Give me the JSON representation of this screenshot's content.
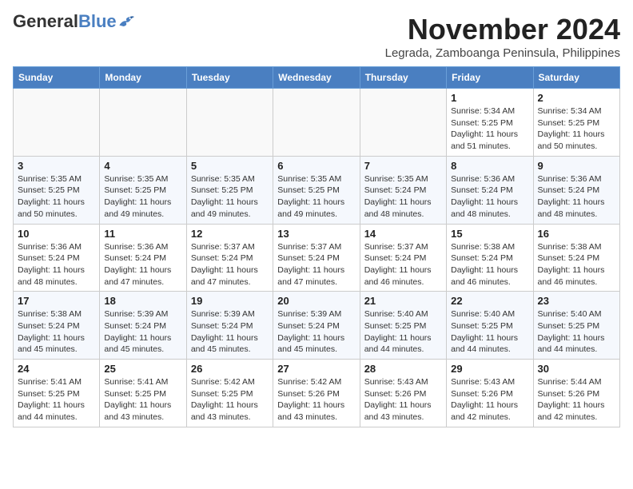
{
  "header": {
    "logo_general": "General",
    "logo_blue": "Blue",
    "month_title": "November 2024",
    "subtitle": "Legrada, Zamboanga Peninsula, Philippines"
  },
  "weekdays": [
    "Sunday",
    "Monday",
    "Tuesday",
    "Wednesday",
    "Thursday",
    "Friday",
    "Saturday"
  ],
  "weeks": [
    [
      {
        "day": "",
        "info": ""
      },
      {
        "day": "",
        "info": ""
      },
      {
        "day": "",
        "info": ""
      },
      {
        "day": "",
        "info": ""
      },
      {
        "day": "",
        "info": ""
      },
      {
        "day": "1",
        "info": "Sunrise: 5:34 AM\nSunset: 5:25 PM\nDaylight: 11 hours and 51 minutes."
      },
      {
        "day": "2",
        "info": "Sunrise: 5:34 AM\nSunset: 5:25 PM\nDaylight: 11 hours and 50 minutes."
      }
    ],
    [
      {
        "day": "3",
        "info": "Sunrise: 5:35 AM\nSunset: 5:25 PM\nDaylight: 11 hours and 50 minutes."
      },
      {
        "day": "4",
        "info": "Sunrise: 5:35 AM\nSunset: 5:25 PM\nDaylight: 11 hours and 49 minutes."
      },
      {
        "day": "5",
        "info": "Sunrise: 5:35 AM\nSunset: 5:25 PM\nDaylight: 11 hours and 49 minutes."
      },
      {
        "day": "6",
        "info": "Sunrise: 5:35 AM\nSunset: 5:25 PM\nDaylight: 11 hours and 49 minutes."
      },
      {
        "day": "7",
        "info": "Sunrise: 5:35 AM\nSunset: 5:24 PM\nDaylight: 11 hours and 48 minutes."
      },
      {
        "day": "8",
        "info": "Sunrise: 5:36 AM\nSunset: 5:24 PM\nDaylight: 11 hours and 48 minutes."
      },
      {
        "day": "9",
        "info": "Sunrise: 5:36 AM\nSunset: 5:24 PM\nDaylight: 11 hours and 48 minutes."
      }
    ],
    [
      {
        "day": "10",
        "info": "Sunrise: 5:36 AM\nSunset: 5:24 PM\nDaylight: 11 hours and 48 minutes."
      },
      {
        "day": "11",
        "info": "Sunrise: 5:36 AM\nSunset: 5:24 PM\nDaylight: 11 hours and 47 minutes."
      },
      {
        "day": "12",
        "info": "Sunrise: 5:37 AM\nSunset: 5:24 PM\nDaylight: 11 hours and 47 minutes."
      },
      {
        "day": "13",
        "info": "Sunrise: 5:37 AM\nSunset: 5:24 PM\nDaylight: 11 hours and 47 minutes."
      },
      {
        "day": "14",
        "info": "Sunrise: 5:37 AM\nSunset: 5:24 PM\nDaylight: 11 hours and 46 minutes."
      },
      {
        "day": "15",
        "info": "Sunrise: 5:38 AM\nSunset: 5:24 PM\nDaylight: 11 hours and 46 minutes."
      },
      {
        "day": "16",
        "info": "Sunrise: 5:38 AM\nSunset: 5:24 PM\nDaylight: 11 hours and 46 minutes."
      }
    ],
    [
      {
        "day": "17",
        "info": "Sunrise: 5:38 AM\nSunset: 5:24 PM\nDaylight: 11 hours and 45 minutes."
      },
      {
        "day": "18",
        "info": "Sunrise: 5:39 AM\nSunset: 5:24 PM\nDaylight: 11 hours and 45 minutes."
      },
      {
        "day": "19",
        "info": "Sunrise: 5:39 AM\nSunset: 5:24 PM\nDaylight: 11 hours and 45 minutes."
      },
      {
        "day": "20",
        "info": "Sunrise: 5:39 AM\nSunset: 5:24 PM\nDaylight: 11 hours and 45 minutes."
      },
      {
        "day": "21",
        "info": "Sunrise: 5:40 AM\nSunset: 5:25 PM\nDaylight: 11 hours and 44 minutes."
      },
      {
        "day": "22",
        "info": "Sunrise: 5:40 AM\nSunset: 5:25 PM\nDaylight: 11 hours and 44 minutes."
      },
      {
        "day": "23",
        "info": "Sunrise: 5:40 AM\nSunset: 5:25 PM\nDaylight: 11 hours and 44 minutes."
      }
    ],
    [
      {
        "day": "24",
        "info": "Sunrise: 5:41 AM\nSunset: 5:25 PM\nDaylight: 11 hours and 44 minutes."
      },
      {
        "day": "25",
        "info": "Sunrise: 5:41 AM\nSunset: 5:25 PM\nDaylight: 11 hours and 43 minutes."
      },
      {
        "day": "26",
        "info": "Sunrise: 5:42 AM\nSunset: 5:25 PM\nDaylight: 11 hours and 43 minutes."
      },
      {
        "day": "27",
        "info": "Sunrise: 5:42 AM\nSunset: 5:26 PM\nDaylight: 11 hours and 43 minutes."
      },
      {
        "day": "28",
        "info": "Sunrise: 5:43 AM\nSunset: 5:26 PM\nDaylight: 11 hours and 43 minutes."
      },
      {
        "day": "29",
        "info": "Sunrise: 5:43 AM\nSunset: 5:26 PM\nDaylight: 11 hours and 42 minutes."
      },
      {
        "day": "30",
        "info": "Sunrise: 5:44 AM\nSunset: 5:26 PM\nDaylight: 11 hours and 42 minutes."
      }
    ]
  ]
}
